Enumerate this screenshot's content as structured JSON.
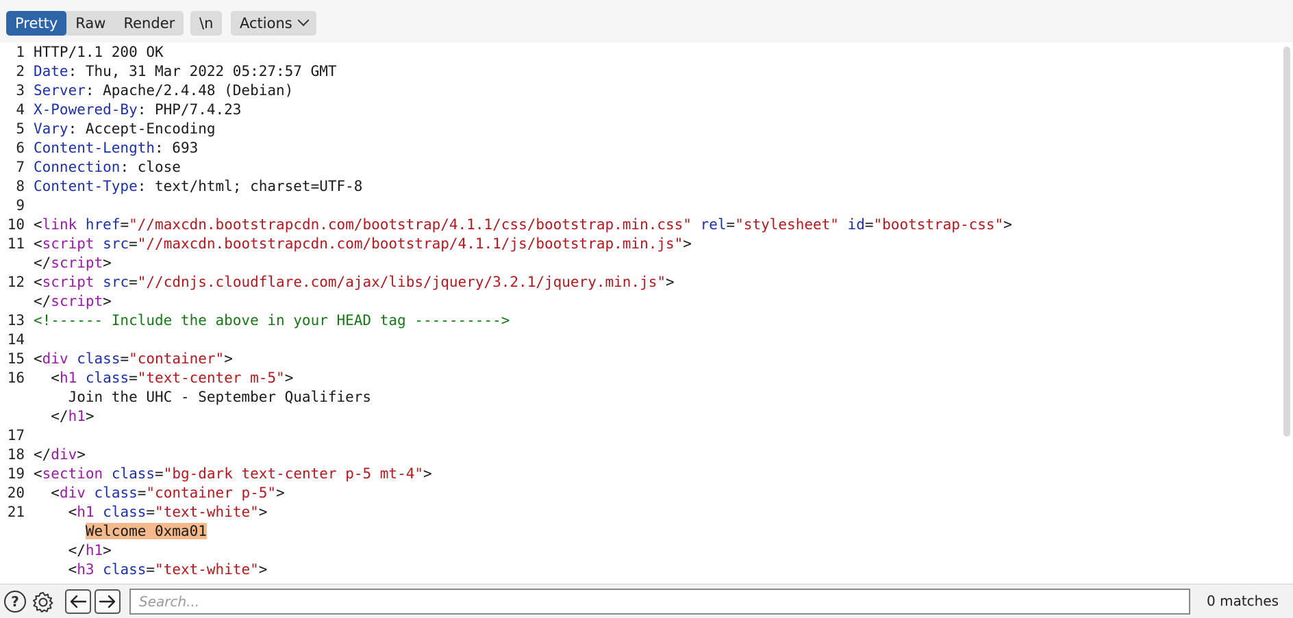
{
  "toolbar": {
    "tabs": [
      "Pretty",
      "Raw",
      "Render"
    ],
    "newline_toggle": "\\n",
    "actions_label": "Actions"
  },
  "lines": [
    {
      "n": "1",
      "parts": [
        [
          "",
          "HTTP/1.1 200 OK"
        ]
      ]
    },
    {
      "n": "2",
      "parts": [
        [
          "key",
          "Date"
        ],
        [
          "",
          ": Thu, 31 Mar 2022 05:27:57 GMT"
        ]
      ]
    },
    {
      "n": "3",
      "parts": [
        [
          "key",
          "Server"
        ],
        [
          "",
          ": Apache/2.4.48 (Debian)"
        ]
      ]
    },
    {
      "n": "4",
      "parts": [
        [
          "key",
          "X-Powered-By"
        ],
        [
          "",
          ": PHP/7.4.23"
        ]
      ]
    },
    {
      "n": "5",
      "parts": [
        [
          "key",
          "Vary"
        ],
        [
          "",
          ": Accept-Encoding"
        ]
      ]
    },
    {
      "n": "6",
      "parts": [
        [
          "key",
          "Content-Length"
        ],
        [
          "",
          ": 693"
        ]
      ]
    },
    {
      "n": "7",
      "parts": [
        [
          "key",
          "Connection"
        ],
        [
          "",
          ": close"
        ]
      ]
    },
    {
      "n": "8",
      "parts": [
        [
          "key",
          "Content-Type"
        ],
        [
          "",
          ": text/html; charset=UTF-8"
        ]
      ]
    },
    {
      "n": "9",
      "parts": []
    },
    {
      "n": "10",
      "parts": [
        [
          "",
          "<"
        ],
        [
          "tag",
          "link"
        ],
        [
          "",
          " "
        ],
        [
          "attr",
          "href"
        ],
        [
          "",
          "="
        ],
        [
          "str",
          "\"//maxcdn.bootstrapcdn.com/bootstrap/4.1.1/css/bootstrap.min.css\""
        ],
        [
          "",
          " "
        ],
        [
          "attr",
          "rel"
        ],
        [
          "",
          "="
        ],
        [
          "str",
          "\"stylesheet\""
        ],
        [
          "",
          " "
        ],
        [
          "attr",
          "id"
        ],
        [
          "",
          "="
        ],
        [
          "str",
          "\"bootstrap-css\""
        ],
        [
          "",
          ">"
        ]
      ]
    },
    {
      "n": "11",
      "parts": [
        [
          "",
          "<"
        ],
        [
          "tag",
          "script"
        ],
        [
          "",
          " "
        ],
        [
          "attr",
          "src"
        ],
        [
          "",
          "="
        ],
        [
          "str",
          "\"//maxcdn.bootstrapcdn.com/bootstrap/4.1.1/js/bootstrap.min.js\""
        ],
        [
          "",
          ">"
        ]
      ]
    },
    {
      "n": "",
      "parts": [
        [
          "",
          "</"
        ],
        [
          "tag",
          "script"
        ],
        [
          "",
          ">"
        ]
      ]
    },
    {
      "n": "12",
      "parts": [
        [
          "",
          "<"
        ],
        [
          "tag",
          "script"
        ],
        [
          "",
          " "
        ],
        [
          "attr",
          "src"
        ],
        [
          "",
          "="
        ],
        [
          "str",
          "\"//cdnjs.cloudflare.com/ajax/libs/jquery/3.2.1/jquery.min.js\""
        ],
        [
          "",
          ">"
        ]
      ]
    },
    {
      "n": "",
      "parts": [
        [
          "",
          "</"
        ],
        [
          "tag",
          "script"
        ],
        [
          "",
          ">"
        ]
      ]
    },
    {
      "n": "13",
      "parts": [
        [
          "comment",
          "<!------ Include the above in your HEAD tag ---------->"
        ]
      ]
    },
    {
      "n": "14",
      "parts": []
    },
    {
      "n": "15",
      "parts": [
        [
          "",
          "<"
        ],
        [
          "tag",
          "div"
        ],
        [
          "",
          " "
        ],
        [
          "attr",
          "class"
        ],
        [
          "",
          "="
        ],
        [
          "str",
          "\"container\""
        ],
        [
          "",
          ">"
        ]
      ]
    },
    {
      "n": "16",
      "parts": [
        [
          "",
          "  <"
        ],
        [
          "tag",
          "h1"
        ],
        [
          "",
          " "
        ],
        [
          "attr",
          "class"
        ],
        [
          "",
          "="
        ],
        [
          "str",
          "\"text-center m-5\""
        ],
        [
          "",
          ">"
        ]
      ]
    },
    {
      "n": "",
      "parts": [
        [
          "",
          "    Join the UHC - September Qualifiers"
        ]
      ]
    },
    {
      "n": "",
      "parts": [
        [
          "",
          "  </"
        ],
        [
          "tag",
          "h1"
        ],
        [
          "",
          ">"
        ]
      ]
    },
    {
      "n": "17",
      "parts": []
    },
    {
      "n": "18",
      "parts": [
        [
          "",
          "</"
        ],
        [
          "tag",
          "div"
        ],
        [
          "",
          ">"
        ]
      ]
    },
    {
      "n": "19",
      "parts": [
        [
          "",
          "<"
        ],
        [
          "tag",
          "section"
        ],
        [
          "",
          " "
        ],
        [
          "attr",
          "class"
        ],
        [
          "",
          "="
        ],
        [
          "str",
          "\"bg-dark text-center p-5 mt-4\""
        ],
        [
          "",
          ">"
        ]
      ]
    },
    {
      "n": "20",
      "parts": [
        [
          "",
          "  <"
        ],
        [
          "tag",
          "div"
        ],
        [
          "",
          " "
        ],
        [
          "attr",
          "class"
        ],
        [
          "",
          "="
        ],
        [
          "str",
          "\"container p-5\""
        ],
        [
          "",
          ">"
        ]
      ]
    },
    {
      "n": "21",
      "parts": [
        [
          "",
          "    <"
        ],
        [
          "tag",
          "h1"
        ],
        [
          "",
          " "
        ],
        [
          "attr",
          "class"
        ],
        [
          "",
          "="
        ],
        [
          "str",
          "\"text-white\""
        ],
        [
          "",
          ">"
        ]
      ]
    },
    {
      "n": "",
      "parts": [
        [
          "",
          "      "
        ],
        [
          "hl",
          "Welcome 0xma01"
        ]
      ]
    },
    {
      "n": "",
      "parts": [
        [
          "",
          "    </"
        ],
        [
          "tag",
          "h1"
        ],
        [
          "",
          ">"
        ]
      ]
    },
    {
      "n": "",
      "parts": [
        [
          "",
          "    <"
        ],
        [
          "tag",
          "h3"
        ],
        [
          "",
          " "
        ],
        [
          "attr",
          "class"
        ],
        [
          "",
          "="
        ],
        [
          "str",
          "\"text-white\""
        ],
        [
          "",
          ">"
        ]
      ]
    }
  ],
  "search": {
    "placeholder": "Search...",
    "value": "",
    "matches": "0 matches"
  },
  "icons": {
    "help": "help-icon",
    "settings": "gear-icon",
    "prev": "arrow-left-icon",
    "next": "arrow-right-icon"
  }
}
